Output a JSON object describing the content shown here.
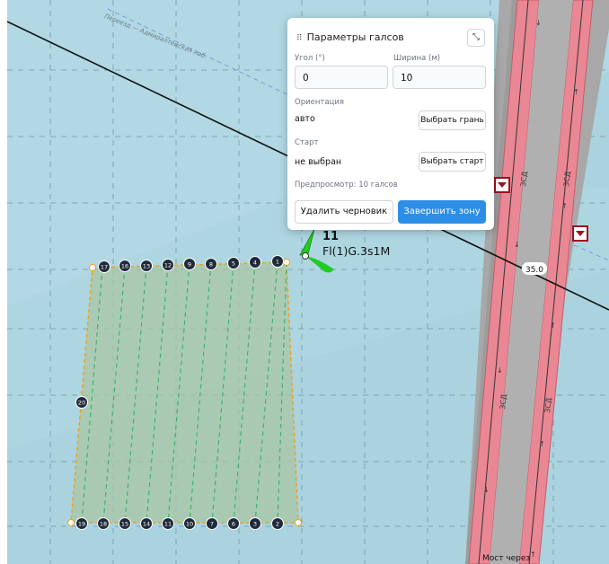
{
  "panel": {
    "title": "Параметры галсов",
    "angle_label": "Угол (°)",
    "angle_value": "0",
    "width_label": "Ширина (м)",
    "width_value": "10",
    "orientation_label": "Ориентация",
    "orientation_value": "авто",
    "choose_edge_button": "Выбрать грань",
    "start_label": "Старт",
    "start_value": "не выбран",
    "choose_start_button": "Выбрать старт",
    "preview_text": "Предпросмотр: 10 галсов",
    "delete_draft_button": "Удалить черновик",
    "finish_zone_button": "Завершить зону"
  },
  "map": {
    "nav_aid_number": "11",
    "nav_aid_light": "Fl(1)G.3s1M",
    "depth_value": "35.0",
    "road_name": "Переезд — Адмиралтейская наб.",
    "lane_markings": [
      "ЗСД",
      "ЗСД",
      "ЗСД",
      "ЗСД"
    ],
    "bridge_label": "Мост через",
    "waypoints_top": [
      "17",
      "16",
      "13",
      "12",
      "9",
      "8",
      "5",
      "4",
      "1"
    ],
    "waypoints_bottom": [
      "19",
      "18",
      "15",
      "14",
      "11",
      "10",
      "7",
      "6",
      "3",
      "2"
    ],
    "waypoint_side": "20",
    "colors": {
      "water": "#aad3df",
      "polygon_fill": "#b2cdae",
      "polygon_edge": "#f0a020",
      "tack_line": "#3cb46e",
      "road_red": "#e07a86",
      "road_grey": "#9e9e9e",
      "nav_green": "#22cc22"
    }
  }
}
